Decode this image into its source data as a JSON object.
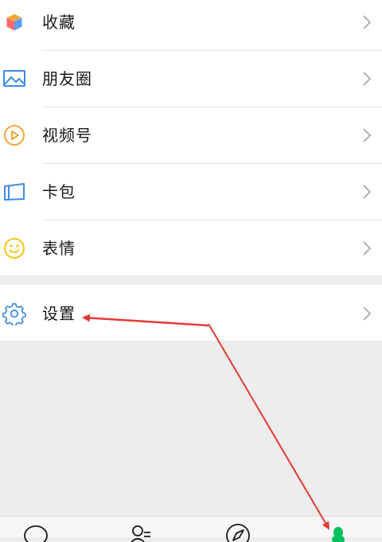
{
  "menu": {
    "items": [
      {
        "label": "收藏",
        "icon": "favorites-cube-icon"
      },
      {
        "label": "朋友圈",
        "icon": "moments-image-icon"
      },
      {
        "label": "视频号",
        "icon": "channels-play-icon"
      },
      {
        "label": "卡包",
        "icon": "card-wallet-icon"
      },
      {
        "label": "表情",
        "icon": "sticker-smiley-icon"
      }
    ],
    "settings": {
      "label": "设置",
      "icon": "gear-icon"
    }
  },
  "tabbar": {
    "tabs": [
      {
        "icon": "chats-bubble-icon"
      },
      {
        "icon": "contacts-person-icon"
      },
      {
        "icon": "discover-compass-icon"
      },
      {
        "icon": "me-person-icon",
        "active": true
      }
    ]
  },
  "colors": {
    "accent_green": "#07c160",
    "annotation_red": "#e53935",
    "page_bg": "#ededed",
    "chevron": "#b2b2b2"
  }
}
